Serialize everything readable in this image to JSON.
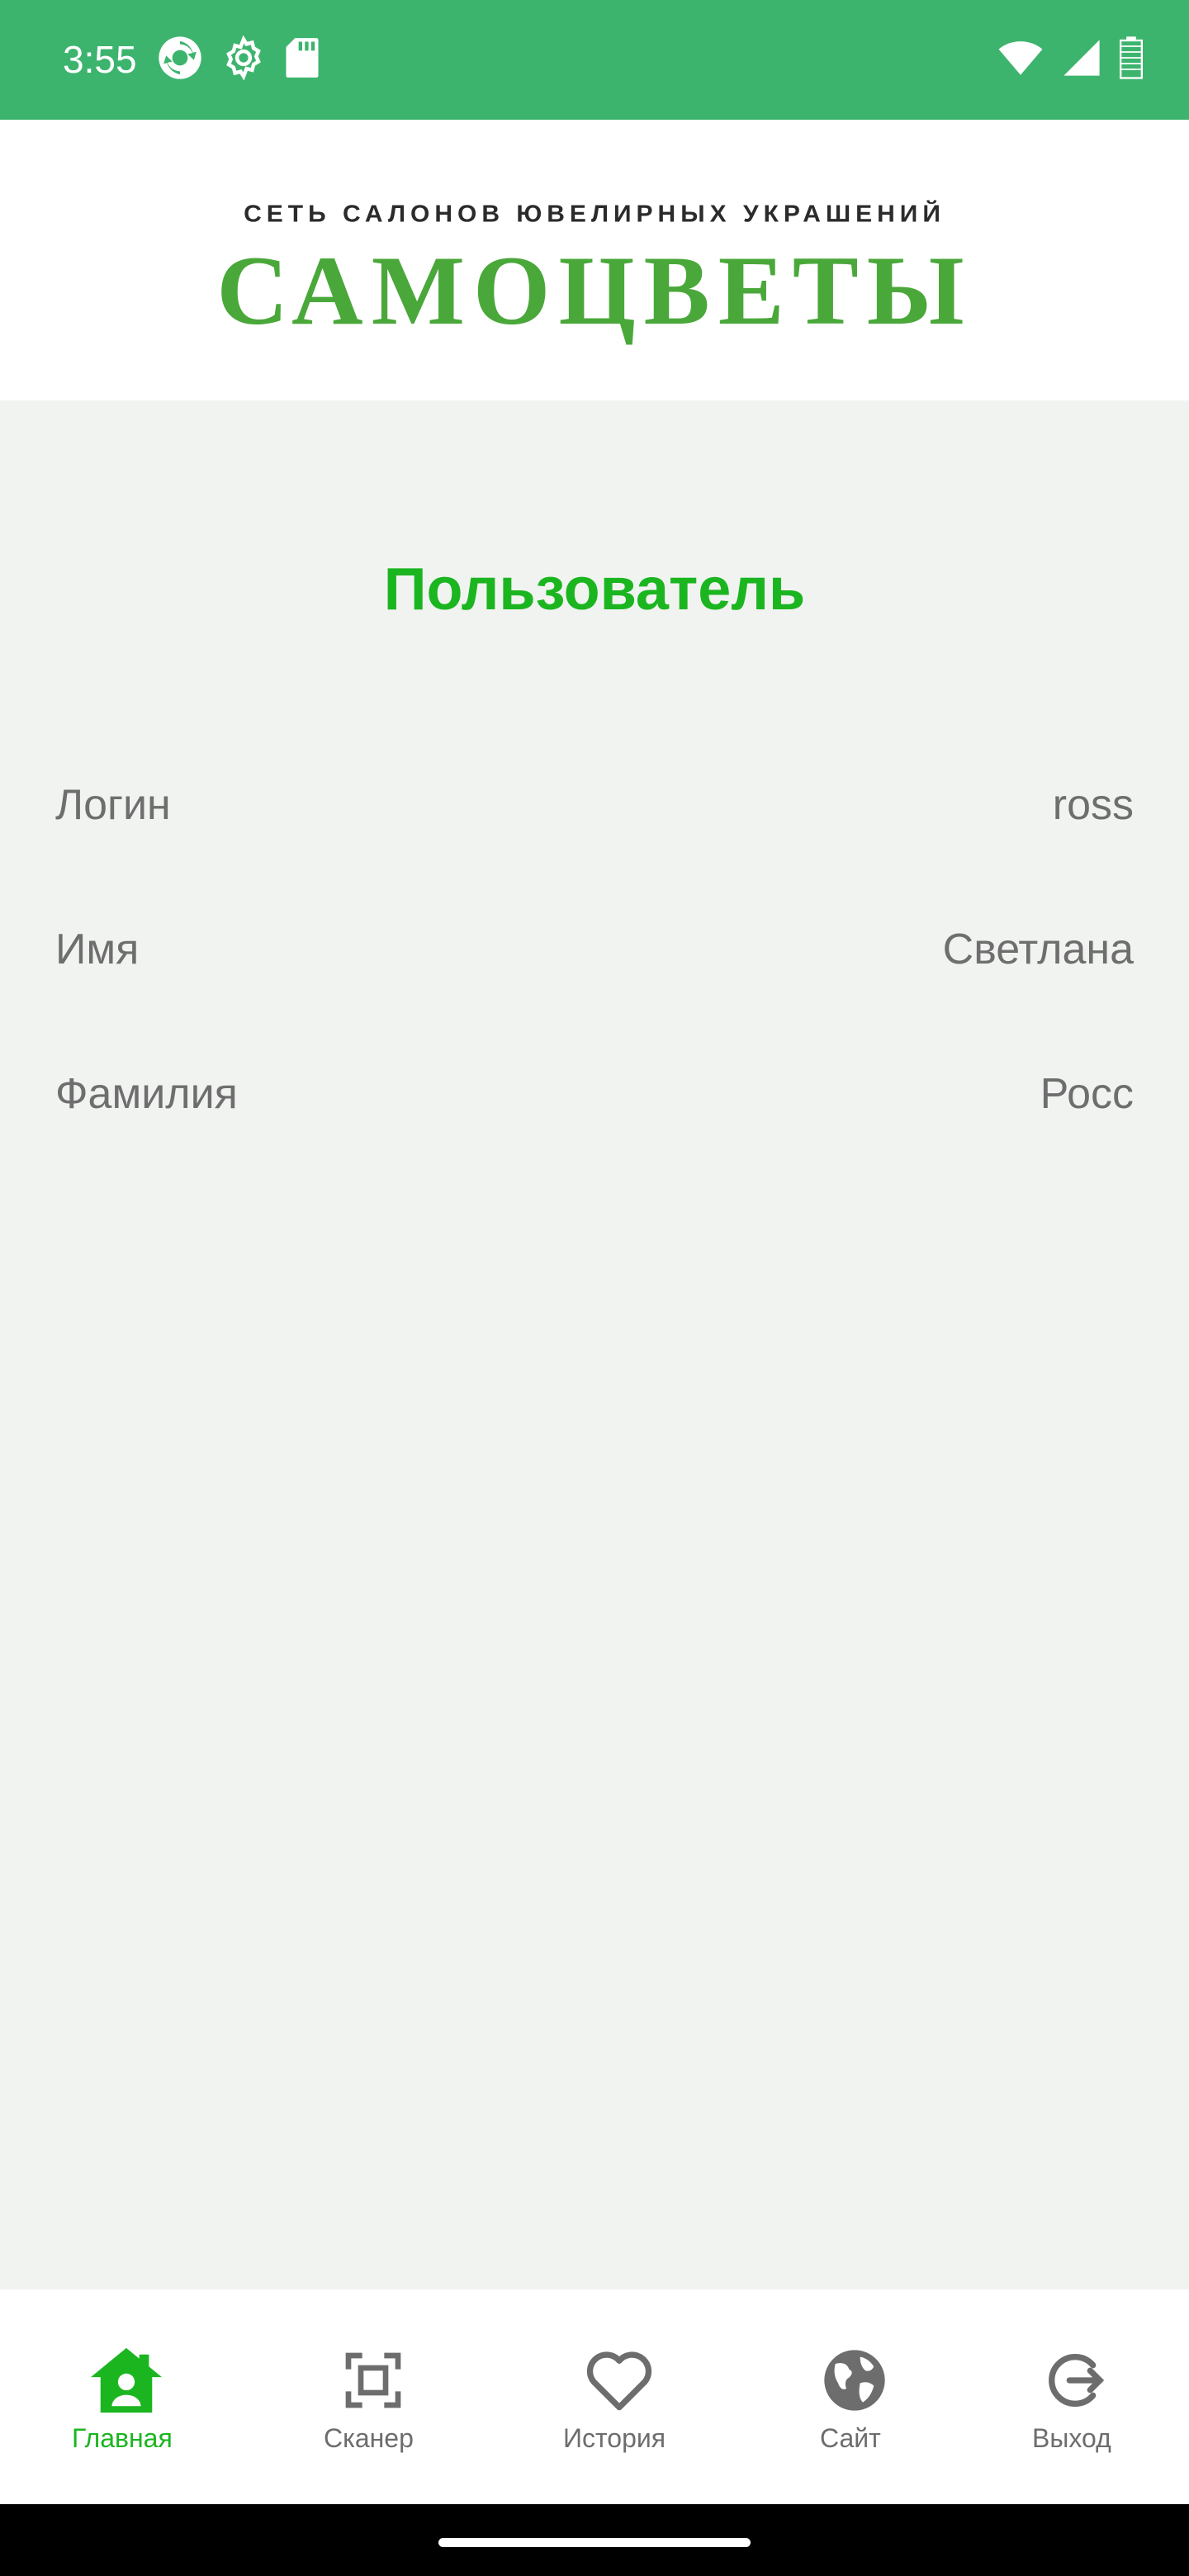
{
  "status_bar": {
    "time": "3:55",
    "background_color": "#3db46e",
    "left_icons": [
      "sync-icon",
      "settings-gear-icon",
      "sd-card-icon"
    ],
    "right_icons": [
      "wifi-icon",
      "cellular-signal-icon",
      "battery-icon"
    ]
  },
  "header": {
    "logo_subtitle": "СЕТЬ САЛОНОВ ЮВЕЛИРНЫХ УКРАШЕНИЙ",
    "logo_title": "САМОЦВЕТЫ",
    "logo_color": "#4aa83a"
  },
  "main": {
    "title": "Пользователь",
    "title_color": "#1bb520",
    "rows": [
      {
        "label": "Логин",
        "value": "ross"
      },
      {
        "label": "Имя",
        "value": "Светлана"
      },
      {
        "label": "Фамилия",
        "value": "Росс"
      }
    ]
  },
  "bottom_nav": {
    "active_color": "#1bb520",
    "inactive_color": "#6d6d6d",
    "items": [
      {
        "label": "Главная",
        "icon": "home-icon",
        "active": true
      },
      {
        "label": "Сканер",
        "icon": "scanner-icon",
        "active": false
      },
      {
        "label": "История",
        "icon": "heart-icon",
        "active": false
      },
      {
        "label": "Сайт",
        "icon": "globe-icon",
        "active": false
      },
      {
        "label": "Выход",
        "icon": "logout-icon",
        "active": false
      }
    ]
  }
}
